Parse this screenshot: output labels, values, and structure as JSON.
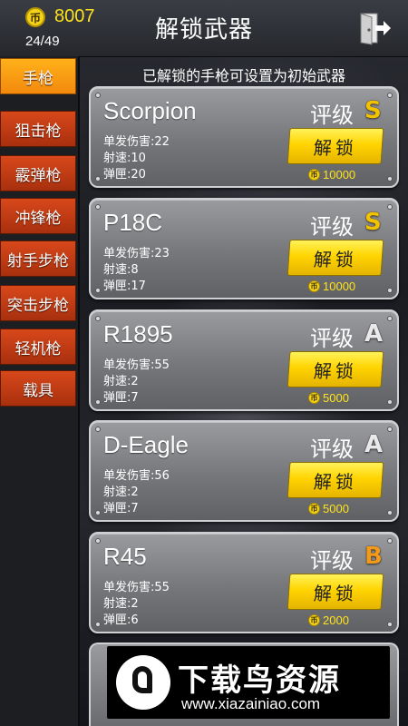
{
  "header": {
    "coins": "8007",
    "coin_symbol": "币",
    "progress": "24/49",
    "title": "解锁武器"
  },
  "sidebar": {
    "tabs": [
      {
        "label": "手枪",
        "active": true
      },
      {
        "label": "狙击枪",
        "active": false
      },
      {
        "label": "霰弹枪",
        "active": false
      },
      {
        "label": "冲锋枪",
        "active": false
      },
      {
        "label": "射手步枪",
        "active": false
      },
      {
        "label": "突击步枪",
        "active": false
      },
      {
        "label": "轻机枪",
        "active": false
      },
      {
        "label": "载具",
        "active": false
      }
    ]
  },
  "main": {
    "subtitle": "已解锁的手枪可设置为初始武器",
    "rating_label": "评级",
    "unlock_label": "解锁",
    "stat_labels": {
      "damage": "单发伤害:",
      "rate": "射速:",
      "magazine": "弹匣:"
    },
    "weapons": [
      {
        "name": "Scorpion",
        "damage": "22",
        "rate": "10",
        "magazine": "20",
        "grade": "S",
        "price": "10000"
      },
      {
        "name": "P18C",
        "damage": "23",
        "rate": "8",
        "magazine": "17",
        "grade": "S",
        "price": "10000"
      },
      {
        "name": "R1895",
        "damage": "55",
        "rate": "2",
        "magazine": "7",
        "grade": "A",
        "price": "5000"
      },
      {
        "name": "D-Eagle",
        "damage": "56",
        "rate": "2",
        "magazine": "7",
        "grade": "A",
        "price": "5000"
      },
      {
        "name": "R45",
        "damage": "55",
        "rate": "2",
        "magazine": "6",
        "grade": "B",
        "price": "2000"
      }
    ]
  },
  "grade_colors": {
    "S": "#f2c200",
    "A": "#e9e9ea",
    "B": "#f39a1a"
  },
  "watermark": {
    "title": "下载鸟资源",
    "url": "www.xiazainiao.com"
  }
}
